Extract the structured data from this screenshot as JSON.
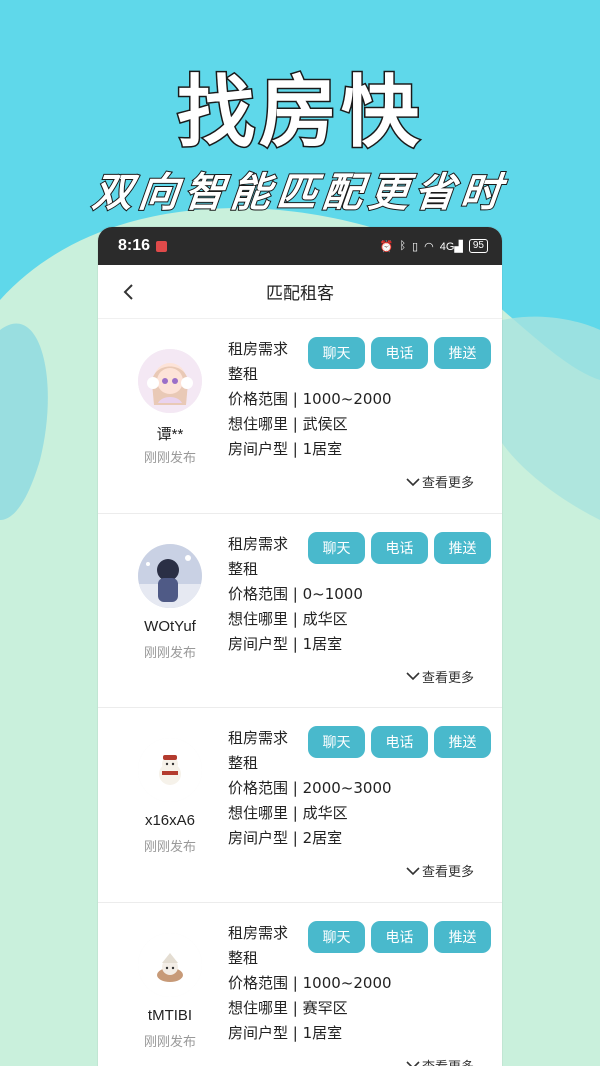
{
  "promo": {
    "title": "找房快",
    "subtitle": "双向智能匹配更省时"
  },
  "colors": {
    "bg_top": "#5fd8ea",
    "bg_bottom": "#c9f0dc",
    "button": "#49b9cc",
    "statusbar": "#2b2b2b"
  },
  "statusbar": {
    "time": "8:16",
    "app_icon": "app-notification-icon",
    "icons": [
      "alarm-icon",
      "bluetooth-icon",
      "vibrate-icon",
      "wifi-icon",
      "4g-signal-icon"
    ],
    "network": "4G",
    "battery": "95"
  },
  "navbar": {
    "back_icon": "chevron-left-icon",
    "title": "匹配租客"
  },
  "buttons": {
    "chat": "聊天",
    "phone": "电话",
    "push": "推送"
  },
  "more_label": "查看更多",
  "tenants": [
    {
      "name": "谭**",
      "time": "刚刚发布",
      "demand": "租房需求",
      "rent_type": "整租",
      "price_label": "价格范围",
      "price": "1000~2000",
      "area_label": "想住哪里",
      "area": "武侯区",
      "room_label": "房间户型",
      "room": "1居室",
      "avatar": "anime-girl-avatar"
    },
    {
      "name": "WOtYuf",
      "time": "刚刚发布",
      "demand": "租房需求",
      "rent_type": "整租",
      "price_label": "价格范围",
      "price": "0~1000",
      "area_label": "想住哪里",
      "area": "成华区",
      "room_label": "房间户型",
      "room": "1居室",
      "avatar": "anime-boy-avatar"
    },
    {
      "name": "x16xA6",
      "time": "刚刚发布",
      "demand": "租房需求",
      "rent_type": "整租",
      "price_label": "价格范围",
      "price": "2000~3000",
      "area_label": "想住哪里",
      "area": "成华区",
      "room_label": "房间户型",
      "room": "2居室",
      "avatar": "polar-bear-avatar"
    },
    {
      "name": "tMTIBI",
      "time": "刚刚发布",
      "demand": "租房需求",
      "rent_type": "整租",
      "price_label": "价格范围",
      "price": "1000~2000",
      "area_label": "想住哪里",
      "area": "赛罕区",
      "room_label": "房间户型",
      "room": "1居室",
      "avatar": "cute-creature-avatar"
    }
  ]
}
